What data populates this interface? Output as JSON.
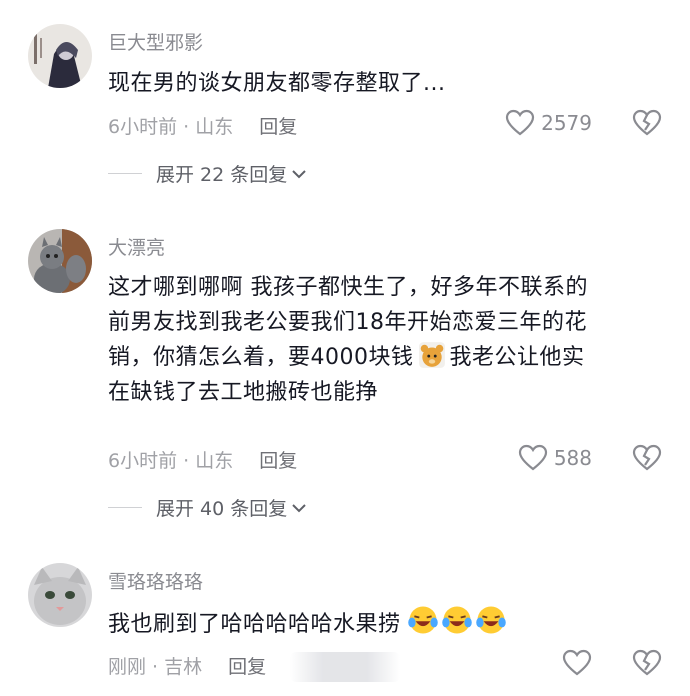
{
  "comments": [
    {
      "username": "巨大型邪影",
      "text": "现在男的谈女朋友都零存整取了...",
      "time": "6小时前 · 山东",
      "reply_label": "回复",
      "likes": "2579",
      "expand_label": "展开 22 条回复"
    },
    {
      "username": "大漂亮",
      "text_line1": "这才哪到哪啊 我孩子都快生了，好多年不联系的",
      "text_line2": "前男友找到我老公要我们18年开始恋爱三年的花",
      "text_line3a": "销，你猜怎么着，要4000块钱",
      "text_line3b": "我老公让他实",
      "text_line4": "在缺钱了去工地搬砖也能挣",
      "time": "6小时前 · 山东",
      "reply_label": "回复",
      "likes": "588",
      "expand_label": "展开 40 条回复"
    },
    {
      "username": "雪珞珞珞珞",
      "text": "我也刷到了哈哈哈哈哈水果捞",
      "time": "刚刚 · 吉林",
      "reply_label": "回复"
    }
  ],
  "icons": {
    "like": "heart-outline-icon",
    "dislike": "broken-heart-icon",
    "expand": "chevron-down-icon"
  }
}
